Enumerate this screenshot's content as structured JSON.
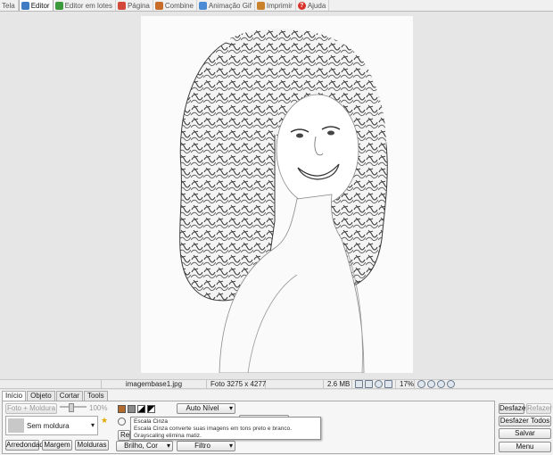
{
  "top_tabs": [
    {
      "label": "Tela",
      "icon": "screen-icon",
      "color": "#4a78b8"
    },
    {
      "label": "Editor",
      "icon": "editor-icon",
      "color": "#3f7cc4",
      "active": true
    },
    {
      "label": "Editor em lotes",
      "icon": "batch-editor-icon",
      "color": "#3c9a3c"
    },
    {
      "label": "Página",
      "icon": "page-icon",
      "color": "#d2483a"
    },
    {
      "label": "Combine",
      "icon": "combine-icon",
      "color": "#c86c2a"
    },
    {
      "label": "Animação Gif",
      "icon": "gif-animation-icon",
      "color": "#4b8bd6"
    },
    {
      "label": "Imprimir",
      "icon": "print-icon",
      "color": "#c9822b"
    },
    {
      "label": "Ajuda",
      "icon": "help-icon",
      "color": "#d9322b"
    }
  ],
  "status": {
    "filename": "imagembase1.jpg",
    "photo_info": "Foto 3275 x 4277",
    "filesize": "2.6 MB",
    "zoom": "17%"
  },
  "panel_tabs": [
    "Início",
    "Objeto",
    "Cortar",
    "Tools"
  ],
  "panel": {
    "frame_button": "Foto + Moldura",
    "opacity": "100%",
    "frame_name": "Sem moldura",
    "rounded_button": "Arredondado",
    "margin_button": "Margem",
    "frames_button": "Molduras",
    "auto_level": "Auto Nível",
    "brightness": "Brilho, Cor",
    "filter": "Filtro",
    "redim_partial": "Red"
  },
  "tooltip": {
    "title": "Escala Cinza",
    "body": "Escala Cinza converte suas imagens em tons preto e branco. Grayscaling elimina matiz."
  },
  "right_buttons": {
    "undo": "Desfazer",
    "redo": "Refazer",
    "undo_all": "Desfazer Todos",
    "save": "Salvar",
    "menu": "Menu"
  },
  "colors": {
    "accent": "#3f7cc4"
  }
}
